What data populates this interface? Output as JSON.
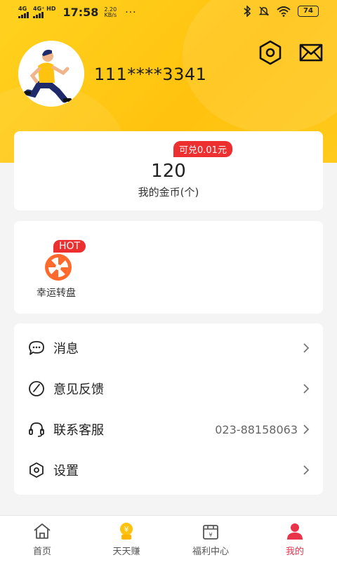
{
  "status_bar": {
    "sig1": "4G",
    "sig2": "4G⁺ HD",
    "time": "17:58",
    "speed_value": "2.20",
    "speed_unit": "KB/s",
    "more": "···",
    "battery": "74"
  },
  "profile": {
    "phone": "111****3341"
  },
  "coins": {
    "exchange_badge": "可兑0.01元",
    "value": "120",
    "label": "我的金币(个)"
  },
  "feature": {
    "badge": "HOT",
    "label": "幸运转盘"
  },
  "menu": {
    "items": [
      {
        "label": "消息",
        "value": "",
        "icon": "chat-icon"
      },
      {
        "label": "意见反馈",
        "value": "",
        "icon": "feedback-icon"
      },
      {
        "label": "联系客服",
        "value": "023-88158063",
        "icon": "headset-icon"
      },
      {
        "label": "设置",
        "value": "",
        "icon": "settings-icon"
      }
    ]
  },
  "tabs": [
    {
      "label": "首页",
      "icon": "home-icon",
      "active": false
    },
    {
      "label": "天天赚",
      "icon": "coin-sign-icon",
      "active": false
    },
    {
      "label": "福利中心",
      "icon": "gift-icon",
      "active": false
    },
    {
      "label": "我的",
      "icon": "profile-icon",
      "active": true
    }
  ],
  "colors": {
    "brand_yellow": "#ffc20e",
    "accent_red": "#e8334a",
    "badge_red": "#ee2f2f"
  }
}
